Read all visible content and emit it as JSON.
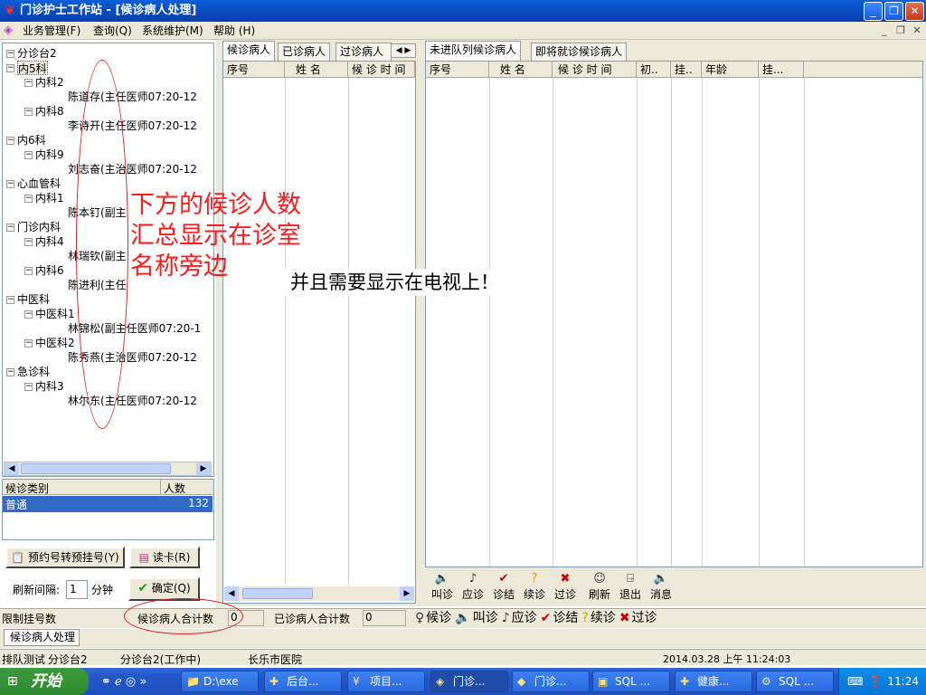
{
  "window": {
    "title": "门诊护士工作站 - [候诊病人处理]",
    "controls": [
      "_",
      "❐",
      "✕"
    ],
    "mdi_controls": [
      "_",
      "❐",
      "✕"
    ]
  },
  "menu": [
    {
      "label": "业务管理(F)"
    },
    {
      "label": "查询(Q)"
    },
    {
      "label": "系统维护(M)"
    },
    {
      "label": "帮助 (H)"
    }
  ],
  "tree": {
    "root": "分诊台2",
    "nodes": [
      {
        "label": "内5科",
        "level": 1,
        "selected": true
      },
      {
        "label": "内科2",
        "level": 2
      },
      {
        "label": "陈道存(主任医师07:20-12",
        "level": 3
      },
      {
        "label": "内科8",
        "level": 2
      },
      {
        "label": "李诗开(主任医师07:20-12",
        "level": 3
      },
      {
        "label": "内6科",
        "level": 1
      },
      {
        "label": "内科9",
        "level": 2
      },
      {
        "label": "刘志奋(主治医师07:20-12",
        "level": 3
      },
      {
        "label": "心血管科",
        "level": 1
      },
      {
        "label": "内科1",
        "level": 2
      },
      {
        "label": "陈本钉(副主",
        "level": 3
      },
      {
        "label": "门诊内科",
        "level": 1
      },
      {
        "label": "内科4",
        "level": 2
      },
      {
        "label": "林瑞钦(副主",
        "level": 3
      },
      {
        "label": "内科6",
        "level": 2
      },
      {
        "label": "陈进利(主任",
        "level": 3
      },
      {
        "label": "中医科",
        "level": 1
      },
      {
        "label": "中医科1",
        "level": 2
      },
      {
        "label": "林锦松(副主任医师07:20-1",
        "level": 3
      },
      {
        "label": "中医科2",
        "level": 2
      },
      {
        "label": "陈秀燕(主治医师07:20-12",
        "level": 3
      },
      {
        "label": "急诊科",
        "level": 1
      },
      {
        "label": "内科3",
        "level": 2
      },
      {
        "label": "林尔东(主任医师07:20-12",
        "level": 3
      }
    ]
  },
  "category_table": {
    "headers": [
      "候诊类别",
      "人数"
    ],
    "rows": [
      {
        "type": "普通",
        "count": "132"
      }
    ]
  },
  "left_buttons": {
    "reserve": "预约号转预挂号(Y)",
    "read_card": "读卡(R)",
    "refresh_label": "刷新间隔:",
    "refresh_value": "1",
    "minutes": "分钟",
    "confirm": "确定(Q)"
  },
  "middle_tabs": [
    "候诊病人",
    "已诊病人",
    "过诊病人"
  ],
  "middle_headers": [
    "序号",
    "姓 名",
    "候 诊 时 间"
  ],
  "right_tabs": [
    "未进队列候诊病人",
    "即将就诊候诊病人"
  ],
  "right_headers": [
    "序号",
    "姓 名",
    "候 诊 时 间",
    "初..",
    "挂..",
    "年龄",
    "挂..."
  ],
  "right_toolbar": [
    "叫诊",
    "应诊",
    "诊结",
    "续诊",
    "过诊",
    "刷新",
    "退出",
    "消息"
  ],
  "status_row": {
    "limit_label": "限制挂号数",
    "waiting_total_label": "候诊病人合计数",
    "waiting_total": "0",
    "seen_total_label": "已诊病人合计数",
    "seen_total": "0",
    "legend": [
      "候诊",
      "叫诊",
      "应诊",
      "诊结",
      "续诊",
      "过诊"
    ]
  },
  "mdi_tab": "候诊病人处理",
  "statusbar": {
    "queue_test": "排队测试",
    "desk": "分诊台2",
    "desk_status": "分诊台2(工作中)",
    "hospital": "长乐市医院",
    "datetime": "2014.03.28 上午 11:24:03"
  },
  "annotations": {
    "red_note_lines": [
      "下方的候诊人数",
      "汇总显示在诊室",
      "名称旁边"
    ],
    "black_note": "并且需要显示在电视上！"
  },
  "taskbar": {
    "start": "开始",
    "items": [
      "D:\\exe",
      "后台...",
      "项目...",
      "门诊...",
      "门诊...",
      "SQL ...",
      "健康...",
      "SQL ..."
    ],
    "clock": "11:24"
  },
  "colors": {
    "title_blue": "#0a4bc2",
    "selection_blue": "#316ac5",
    "annotation_red": "#ff1a1a",
    "button_face": "#ece9d8"
  }
}
